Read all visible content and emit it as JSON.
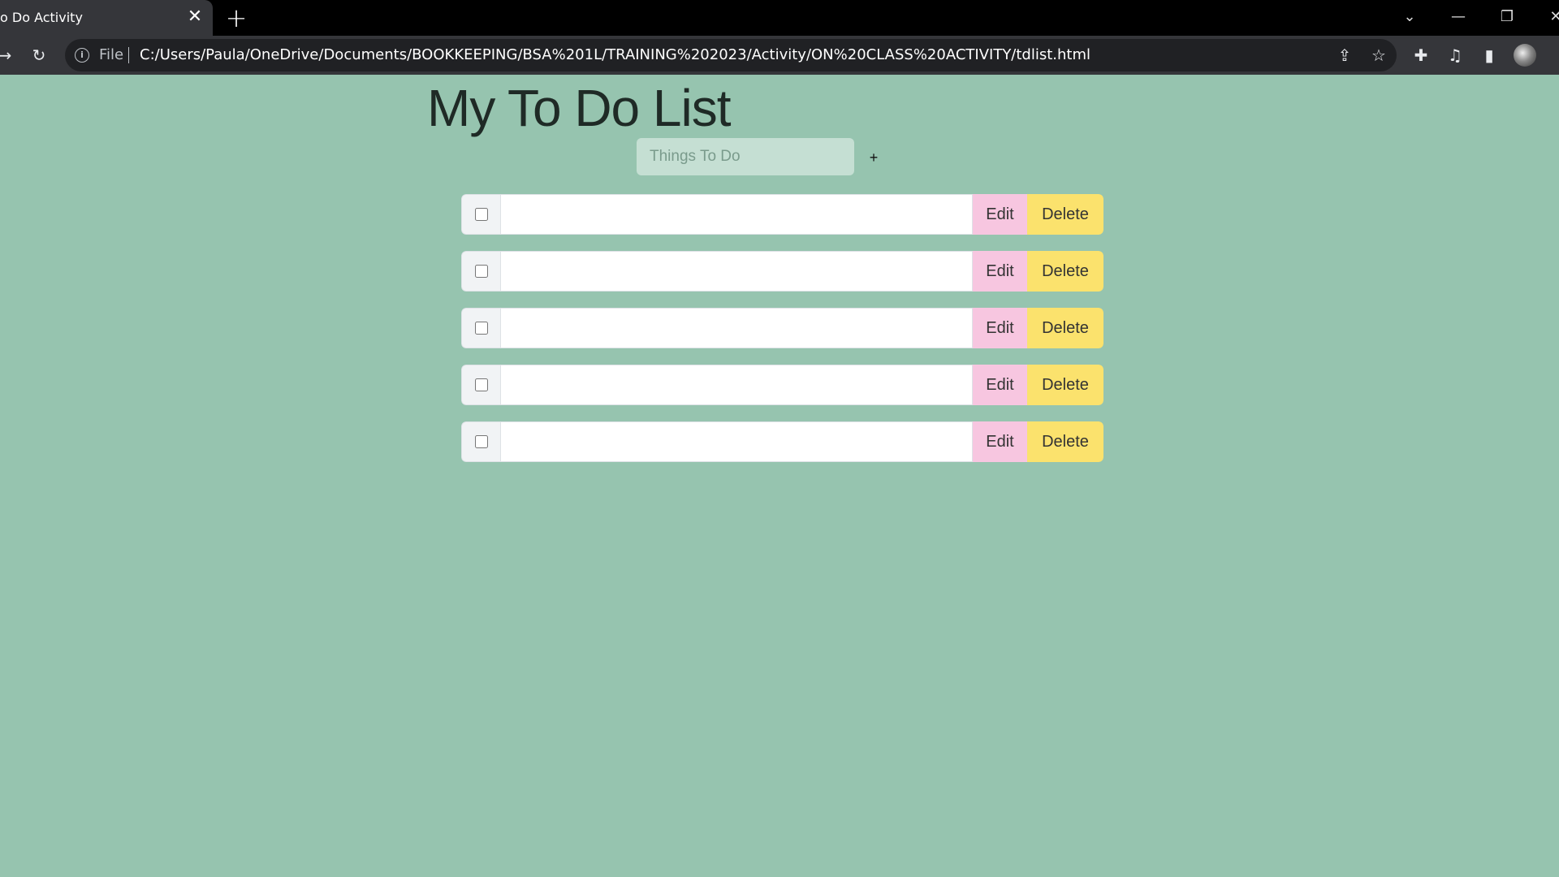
{
  "browser": {
    "tab_title": "o Do Activity",
    "close_tab": "✕",
    "new_tab": "+",
    "scheme_label": "File",
    "url": "C:/Users/Paula/OneDrive/Documents/BOOKKEEPING/BSA%201L/TRAINING%202023/Activity/ON%20CLASS%20ACTIVITY/tdlist.html"
  },
  "page": {
    "title": "My To Do List",
    "input_placeholder": "Things To Do",
    "add_label": "+"
  },
  "todos": [
    {
      "text": "",
      "checked": false,
      "edit_label": "Edit",
      "delete_label": "Delete"
    },
    {
      "text": "",
      "checked": false,
      "edit_label": "Edit",
      "delete_label": "Delete"
    },
    {
      "text": "",
      "checked": false,
      "edit_label": "Edit",
      "delete_label": "Delete"
    },
    {
      "text": "",
      "checked": false,
      "edit_label": "Edit",
      "delete_label": "Delete"
    },
    {
      "text": "",
      "checked": false,
      "edit_label": "Edit",
      "delete_label": "Delete"
    }
  ],
  "colors": {
    "background": "#96c4af",
    "edit_button": "#f7c6e0",
    "delete_button": "#fbe26d",
    "input_bg": "#c5dfd3"
  }
}
